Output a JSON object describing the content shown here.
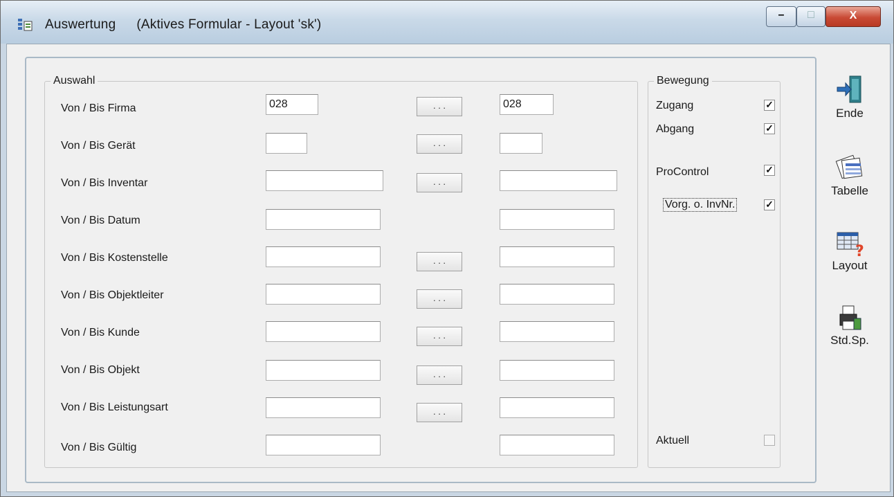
{
  "window": {
    "title": "Auswertung",
    "subtitle": "(Aktives Formular - Layout 'sk')",
    "controls": {
      "minimize": "–",
      "maximize": "□",
      "close": "X"
    }
  },
  "auswahl": {
    "legend": "Auswahl",
    "rows": [
      {
        "label": "Von / Bis Firma",
        "from": "028",
        "to": "028",
        "picker": ". . ."
      },
      {
        "label": "Von / Bis Gerät",
        "from": "",
        "to": "",
        "picker": ". . ."
      },
      {
        "label": "Von / Bis Inventar",
        "from": "",
        "to": "",
        "picker": ". . ."
      },
      {
        "label": "Von / Bis Datum",
        "from": "",
        "to": ""
      },
      {
        "label": "Von / Bis Kostenstelle",
        "from": "",
        "to": "",
        "picker": ". . ."
      },
      {
        "label": "Von / Bis Objektleiter",
        "from": "",
        "to": "",
        "picker": ". . ."
      },
      {
        "label": "Von / Bis Kunde",
        "from": "",
        "to": "",
        "picker": ". . ."
      },
      {
        "label": "Von / Bis Objekt",
        "from": "",
        "to": "",
        "picker": ". . ."
      },
      {
        "label": "Von / Bis Leistungsart",
        "from": "",
        "to": "",
        "picker": ". . ."
      },
      {
        "label": "Von / Bis Gültig",
        "from": "",
        "to": ""
      }
    ]
  },
  "bewegung": {
    "legend": "Bewegung",
    "items": [
      {
        "label": "Zugang",
        "checked": true
      },
      {
        "label": "Abgang",
        "checked": true
      },
      {
        "label": "ProControl",
        "checked": true
      },
      {
        "label": "Vorg. o. InvNr.",
        "checked": true
      },
      {
        "label": "Aktuell",
        "checked": false
      }
    ]
  },
  "toolbar": {
    "ende": {
      "label": "Ende",
      "icon": "exit-door-icon"
    },
    "tabelle": {
      "label": "Tabelle",
      "icon": "table-sheets-icon"
    },
    "layout": {
      "label": "Layout",
      "icon": "layout-grid-icon"
    },
    "stdsp": {
      "label": "Std.Sp.",
      "icon": "printer-icon"
    }
  },
  "colors": {
    "title_bar": "#c9d9e8",
    "close_button": "#c94a35",
    "client": "#f0f0f0"
  }
}
